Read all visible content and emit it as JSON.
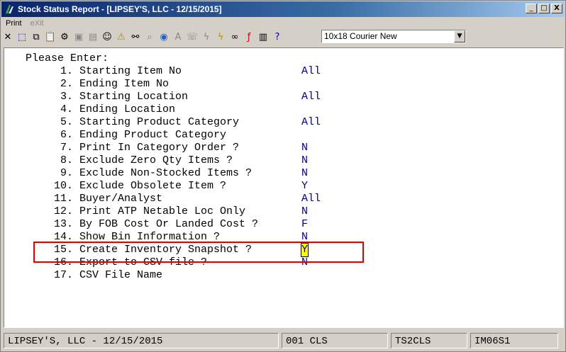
{
  "window": {
    "title": "Stock Status Report - [LIPSEY'S, LLC - 12/15/2015]",
    "buttons": {
      "minimize": "_",
      "maximize": "□",
      "close": "X"
    }
  },
  "menu": [
    {
      "label": "Print",
      "enabled": true
    },
    {
      "label": "eXit",
      "enabled": false
    }
  ],
  "toolbar": {
    "font_select": "10x18 Courier New"
  },
  "screen": {
    "prompt": "Please Enter:",
    "fields": [
      {
        "label": " 1. Starting Item No",
        "value": "All"
      },
      {
        "label": " 2. Ending Item No",
        "value": ""
      },
      {
        "label": " 3. Starting Location",
        "value": "All"
      },
      {
        "label": " 4. Ending Location",
        "value": ""
      },
      {
        "label": " 5. Starting Product Category",
        "value": "All"
      },
      {
        "label": " 6. Ending Product Category",
        "value": ""
      },
      {
        "label": " 7. Print In Category Order ?",
        "value": "N"
      },
      {
        "label": " 8. Exclude Zero Qty Items ?",
        "value": "N"
      },
      {
        "label": " 9. Exclude Non-Stocked Items ?",
        "value": "N"
      },
      {
        "label": "10. Exclude Obsolete Item ?",
        "value": "Y"
      },
      {
        "label": "11. Buyer/Analyst",
        "value": "All"
      },
      {
        "label": "12. Print ATP Netable Loc Only",
        "value": "N"
      },
      {
        "label": "13. By FOB Cost Or Landed Cost ?",
        "value": "F"
      },
      {
        "label": "14. Show Bin Information ?",
        "value": "N"
      },
      {
        "label": "15. Create Inventory Snapshot ?",
        "value": "Y"
      },
      {
        "label": "16. Export to CSV file ?",
        "value": "N"
      },
      {
        "label": "17. CSV File Name",
        "value": ""
      }
    ],
    "active_field_index": 14
  },
  "status": {
    "company": "LIPSEY'S, LLC - 12/15/2015",
    "code": "001 CLS",
    "session": "TS2CLS",
    "program": "IM06S1"
  },
  "colors": {
    "value_text": "#000080",
    "cursor_bg": "#ffff00",
    "highlight_border": "#e00000"
  }
}
